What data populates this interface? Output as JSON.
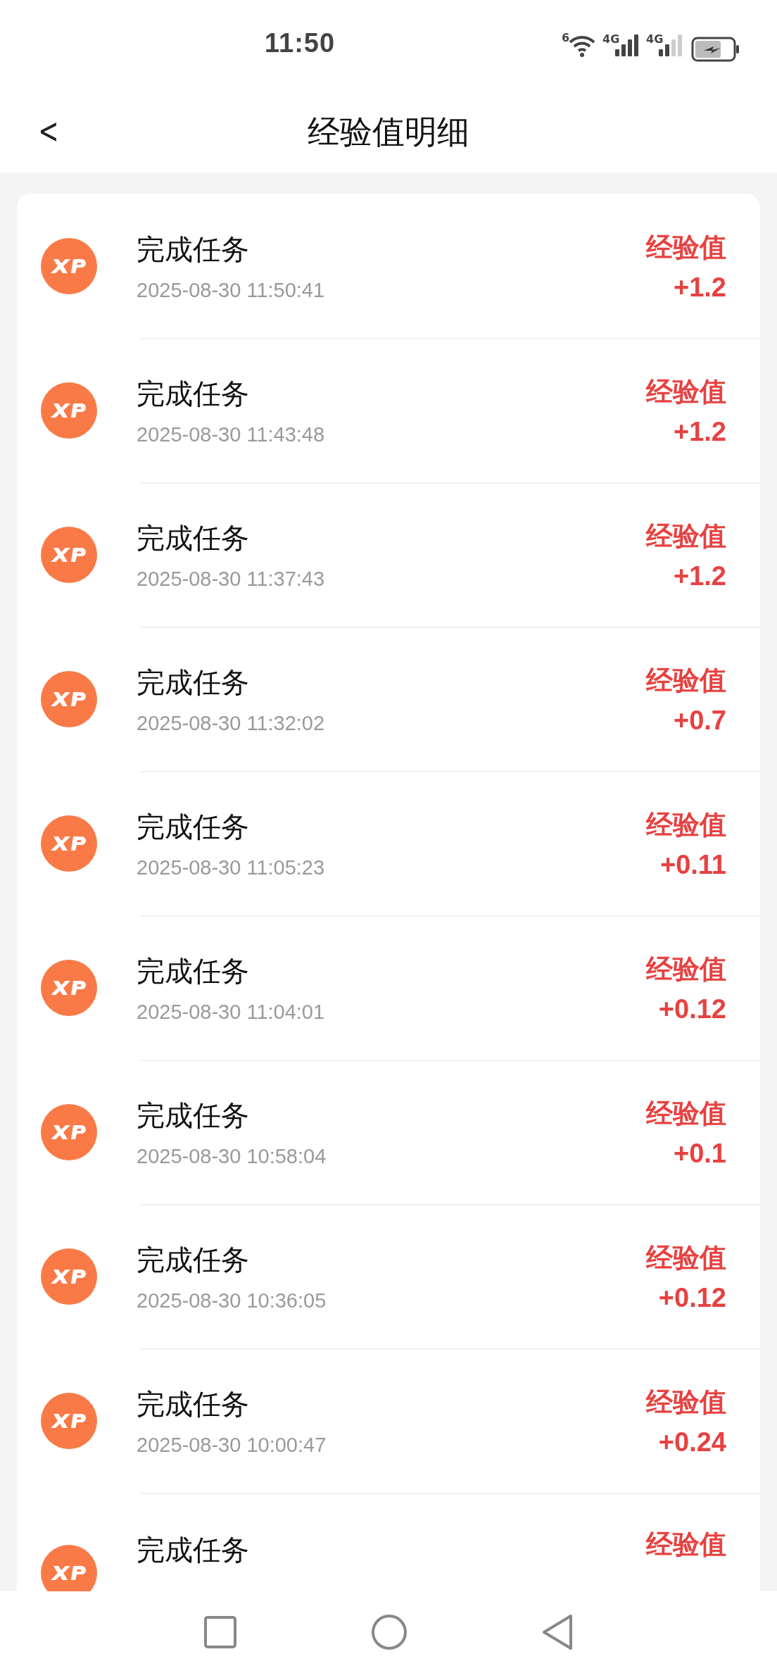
{
  "status_bar": {
    "time": "11:50",
    "wifi_badge": "6",
    "networks": [
      {
        "label": "4G"
      },
      {
        "label": "4G"
      }
    ]
  },
  "header": {
    "back": "<",
    "title": "经验值明细"
  },
  "records": [
    {
      "title": "完成任务",
      "time": "2025-08-30 11:50:41",
      "label": "经验值",
      "amount": "+1.2"
    },
    {
      "title": "完成任务",
      "time": "2025-08-30 11:43:48",
      "label": "经验值",
      "amount": "+1.2"
    },
    {
      "title": "完成任务",
      "time": "2025-08-30 11:37:43",
      "label": "经验值",
      "amount": "+1.2"
    },
    {
      "title": "完成任务",
      "time": "2025-08-30 11:32:02",
      "label": "经验值",
      "amount": "+0.7"
    },
    {
      "title": "完成任务",
      "time": "2025-08-30 11:05:23",
      "label": "经验值",
      "amount": "+0.11"
    },
    {
      "title": "完成任务",
      "time": "2025-08-30 11:04:01",
      "label": "经验值",
      "amount": "+0.12"
    },
    {
      "title": "完成任务",
      "time": "2025-08-30 10:58:04",
      "label": "经验值",
      "amount": "+0.1"
    },
    {
      "title": "完成任务",
      "time": "2025-08-30 10:36:05",
      "label": "经验值",
      "amount": "+0.12"
    },
    {
      "title": "完成任务",
      "time": "2025-08-30 10:00:47",
      "label": "经验值",
      "amount": "+0.24"
    },
    {
      "title": "完成任务",
      "label": "经验值"
    }
  ]
}
